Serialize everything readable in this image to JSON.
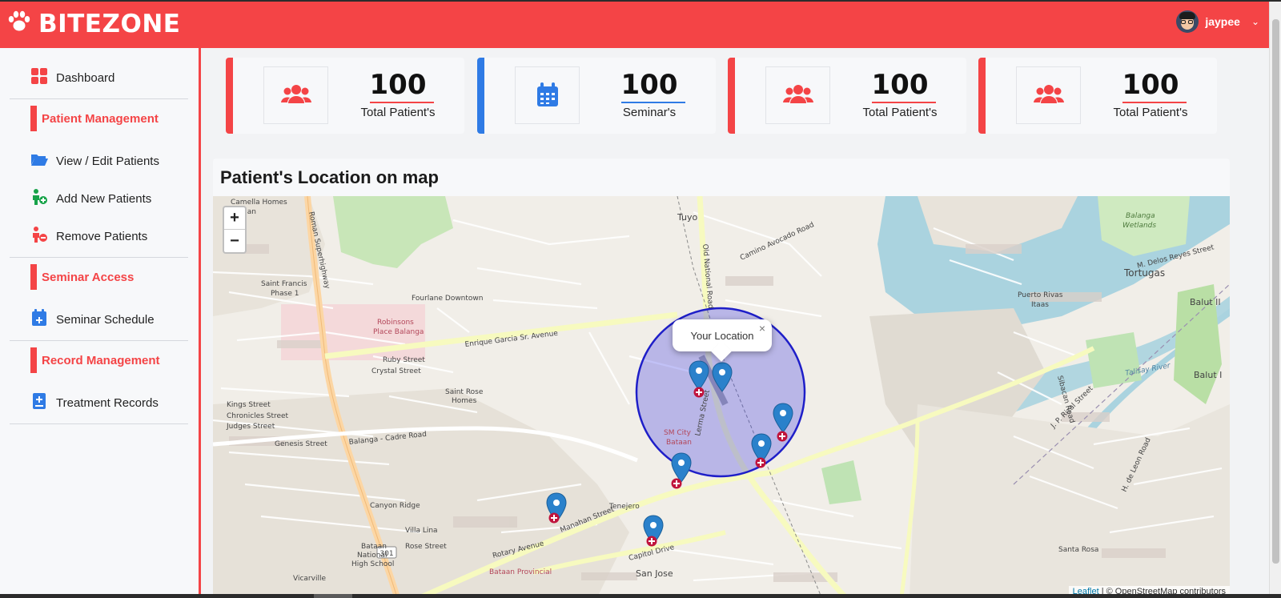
{
  "header": {
    "brand": "BITEZONE",
    "user": "jaypee",
    "colors": {
      "primary": "#f44446"
    },
    "icons": {
      "brand": "paw-icon",
      "menu": "chevron-down-icon"
    }
  },
  "sidebar": {
    "dashboard": "Dashboard",
    "sections": [
      {
        "title": "Patient Management",
        "items": [
          "View / Edit Patients",
          "Add New Patients",
          "Remove Patients"
        ]
      },
      {
        "title": "Seminar Access",
        "items": [
          "Seminar Schedule"
        ]
      },
      {
        "title": "Record Management",
        "items": [
          "Treatment Records"
        ]
      }
    ]
  },
  "stats": [
    {
      "value": "100",
      "label": "Total Patient's",
      "color": "#f44446",
      "icon": "users-icon"
    },
    {
      "value": "100",
      "label": "Seminar's",
      "color": "#2f7be5",
      "icon": "calendar-icon"
    },
    {
      "value": "100",
      "label": "Total Patient's",
      "color": "#f44446",
      "icon": "users-icon"
    },
    {
      "value": "100",
      "label": "Total Patient's",
      "color": "#f44446",
      "icon": "users-icon"
    }
  ],
  "map": {
    "title": "Patient's Location on map",
    "zoom_in": "+",
    "zoom_out": "−",
    "popup": "Your Location",
    "popup_close": "×",
    "attribution_link": "Leaflet",
    "attribution_text": "| © OpenStreetMap contributors",
    "labels": {
      "camella": "Camella Homes",
      "bataan": "Bataan",
      "roman": "Roman Superhighway",
      "tuyo": "Tuyo",
      "oldnat": "Old National Road",
      "stfrancis": "Saint Francis",
      "phase1": "Phase 1",
      "fourlane": "Fourlane Downtown",
      "robinsons1": "Robinsons",
      "robinsons2": "Place Balanga",
      "enrique": "Enrique Garcia Sr. Avenue",
      "ruby": "Ruby Street",
      "crystal": "Crystal Street",
      "strose1": "Saint Rose",
      "strose2": "Homes",
      "kings": "Kings Street",
      "chronicles": "Chronicles Street",
      "judges": "Judges Street",
      "genesis": "Genesis Street",
      "cadre": "Balanga - Cadre Road",
      "smcity1": "SM City",
      "smcity2": "Bataan",
      "lerma": "Lerma Street",
      "canyon": "Canyon Ridge",
      "villalina": "Villa Lina",
      "rose": "Rose Street",
      "bnhs1": "Bataan",
      "bnhs2": "National",
      "bnhs3": "High School",
      "vicarville": "Vicarville",
      "r301": "301",
      "rotary": "Rotary Avenue",
      "manahan": "Manahan Street",
      "tenejero": "Tenejero",
      "capitol": "Capitol Drive",
      "sanjose": "San Jose",
      "provincial": "Bataan Provincial",
      "tortugas": "Tortugas",
      "balut2": "Balut II",
      "balut1": "Balut I",
      "puerto1": "Puerto Rivas",
      "puerto2": "Itaas",
      "wetlands1": "Balanga",
      "wetlands2": "Wetlands",
      "talisay": "Talisay River",
      "jprizal": "J. P. Rizal Street",
      "hdeleon": "H. de Leon Road",
      "santarosa": "Santa Rosa",
      "mdelos": "M. Delos Reyes Street",
      "sibacan": "Sibacan Road",
      "camino": "Camino Avocado Road"
    },
    "marker_color": "#2a81cb",
    "radius_color": "#1e1ec8"
  }
}
